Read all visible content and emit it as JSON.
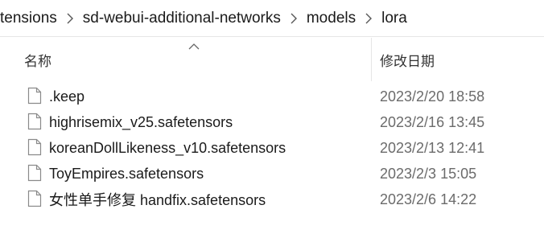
{
  "breadcrumb": {
    "items": [
      {
        "label": "tensions"
      },
      {
        "label": "sd-webui-additional-networks"
      },
      {
        "label": "models"
      },
      {
        "label": "lora"
      }
    ],
    "separator_icon": "chevron-right-icon"
  },
  "columns": {
    "name": "名称",
    "date_modified": "修改日期",
    "sort_icon": "sort-ascending-icon"
  },
  "files": [
    {
      "name": ".keep",
      "date": "2023/2/20 18:58",
      "icon": "file-icon"
    },
    {
      "name": "highrisemix_v25.safetensors",
      "date": "2023/2/16 13:45",
      "icon": "file-icon"
    },
    {
      "name": "koreanDollLikeness_v10.safetensors",
      "date": "2023/2/13 12:41",
      "icon": "file-icon"
    },
    {
      "name": "ToyEmpires.safetensors",
      "date": "2023/2/3 15:05",
      "icon": "file-icon"
    },
    {
      "name": "女性单手修复 handfix.safetensors",
      "date": "2023/2/6 14:22",
      "icon": "file-icon"
    }
  ],
  "colors": {
    "text": "#1a1a1a",
    "date_text": "#6b6b6b",
    "divider": "#e6e6e6",
    "icon_stroke": "#8a8a8a"
  }
}
